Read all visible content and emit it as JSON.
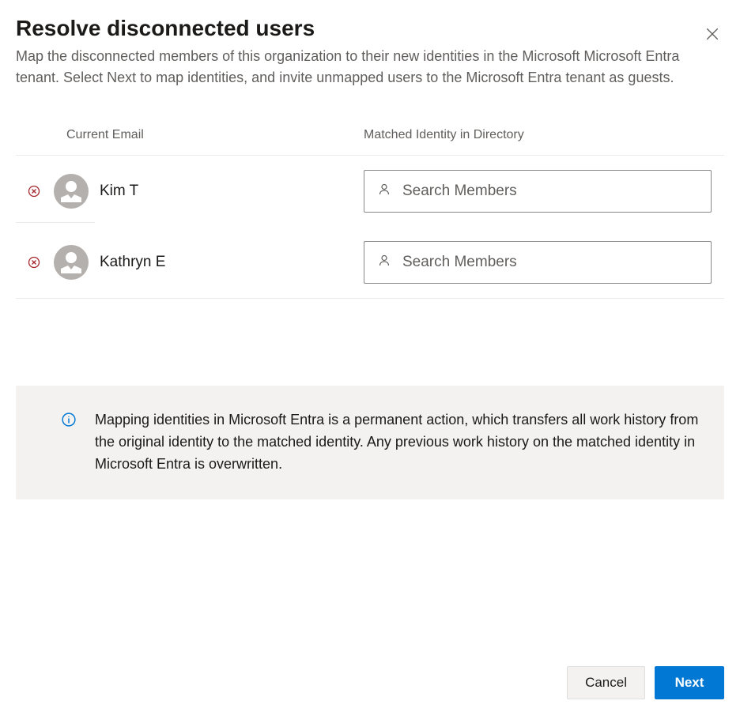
{
  "dialog": {
    "title": "Resolve disconnected users",
    "subtitle": "Map the disconnected members of this organization to their new identities in the Microsoft Microsoft Entra tenant. Select Next to map identities, and invite unmapped users to the Microsoft Entra tenant as guests."
  },
  "table": {
    "headers": {
      "email": "Current Email",
      "identity": "Matched Identity in Directory"
    },
    "search_placeholder": "Search Members"
  },
  "users": [
    {
      "name": "Kim T"
    },
    {
      "name": "Kathryn E"
    }
  ],
  "info": {
    "text": "Mapping identities in Microsoft Entra is a permanent action, which transfers all work history from the original identity to the matched identity. Any previous work history on the matched identity in Microsoft Entra is overwritten."
  },
  "footer": {
    "cancel": "Cancel",
    "next": "Next"
  }
}
